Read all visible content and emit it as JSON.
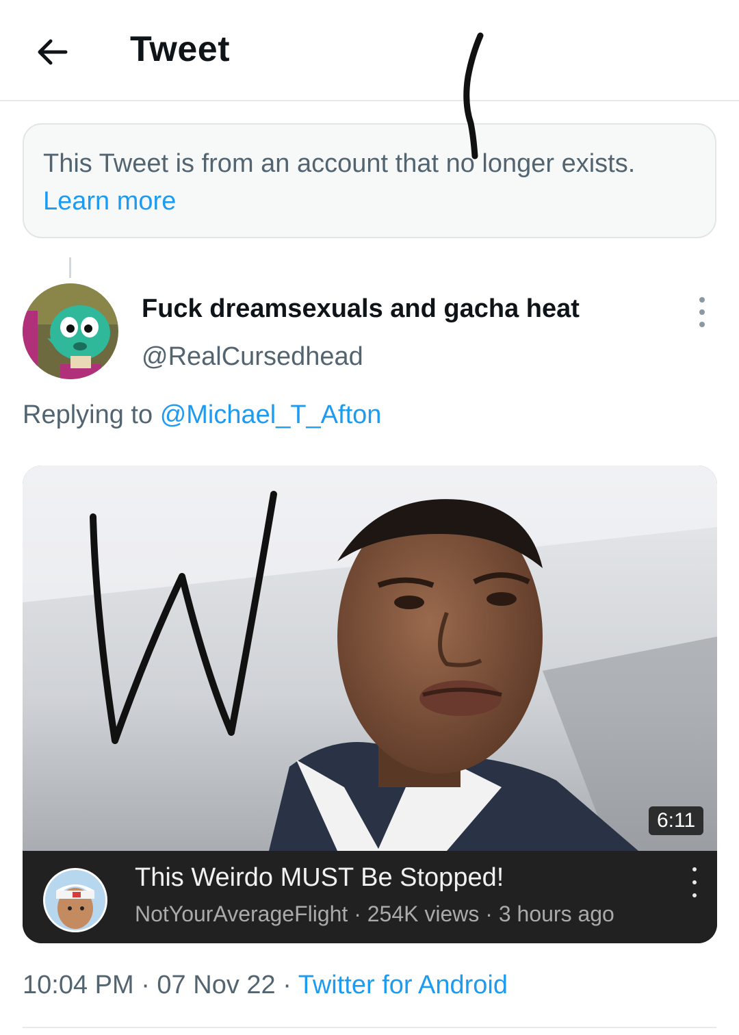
{
  "header": {
    "title": "Tweet",
    "back_icon": "arrow-left-icon"
  },
  "notice": {
    "text": "This Tweet is from an account that no longer exists.",
    "link": "Learn more"
  },
  "tweet": {
    "display_name": "Fuck dreamsexuals and gacha heat",
    "handle": "@RealCursedhead",
    "replying_prefix": "Replying to",
    "replying_handle": "@Michael_T_Afton",
    "timestamp": "10:04 PM · 07 Nov 22 · ",
    "source": "Twitter for Android"
  },
  "media": {
    "duration": "6:11",
    "video_title": "This Weirdo MUST Be Stopped!",
    "channel": "NotYourAverageFlight",
    "views": "254K views",
    "age": "3 hours ago",
    "separator": " · ",
    "handwritten": "W"
  },
  "colors": {
    "link": "#1d9bf0",
    "muted": "#536471",
    "text": "#0f1419"
  }
}
